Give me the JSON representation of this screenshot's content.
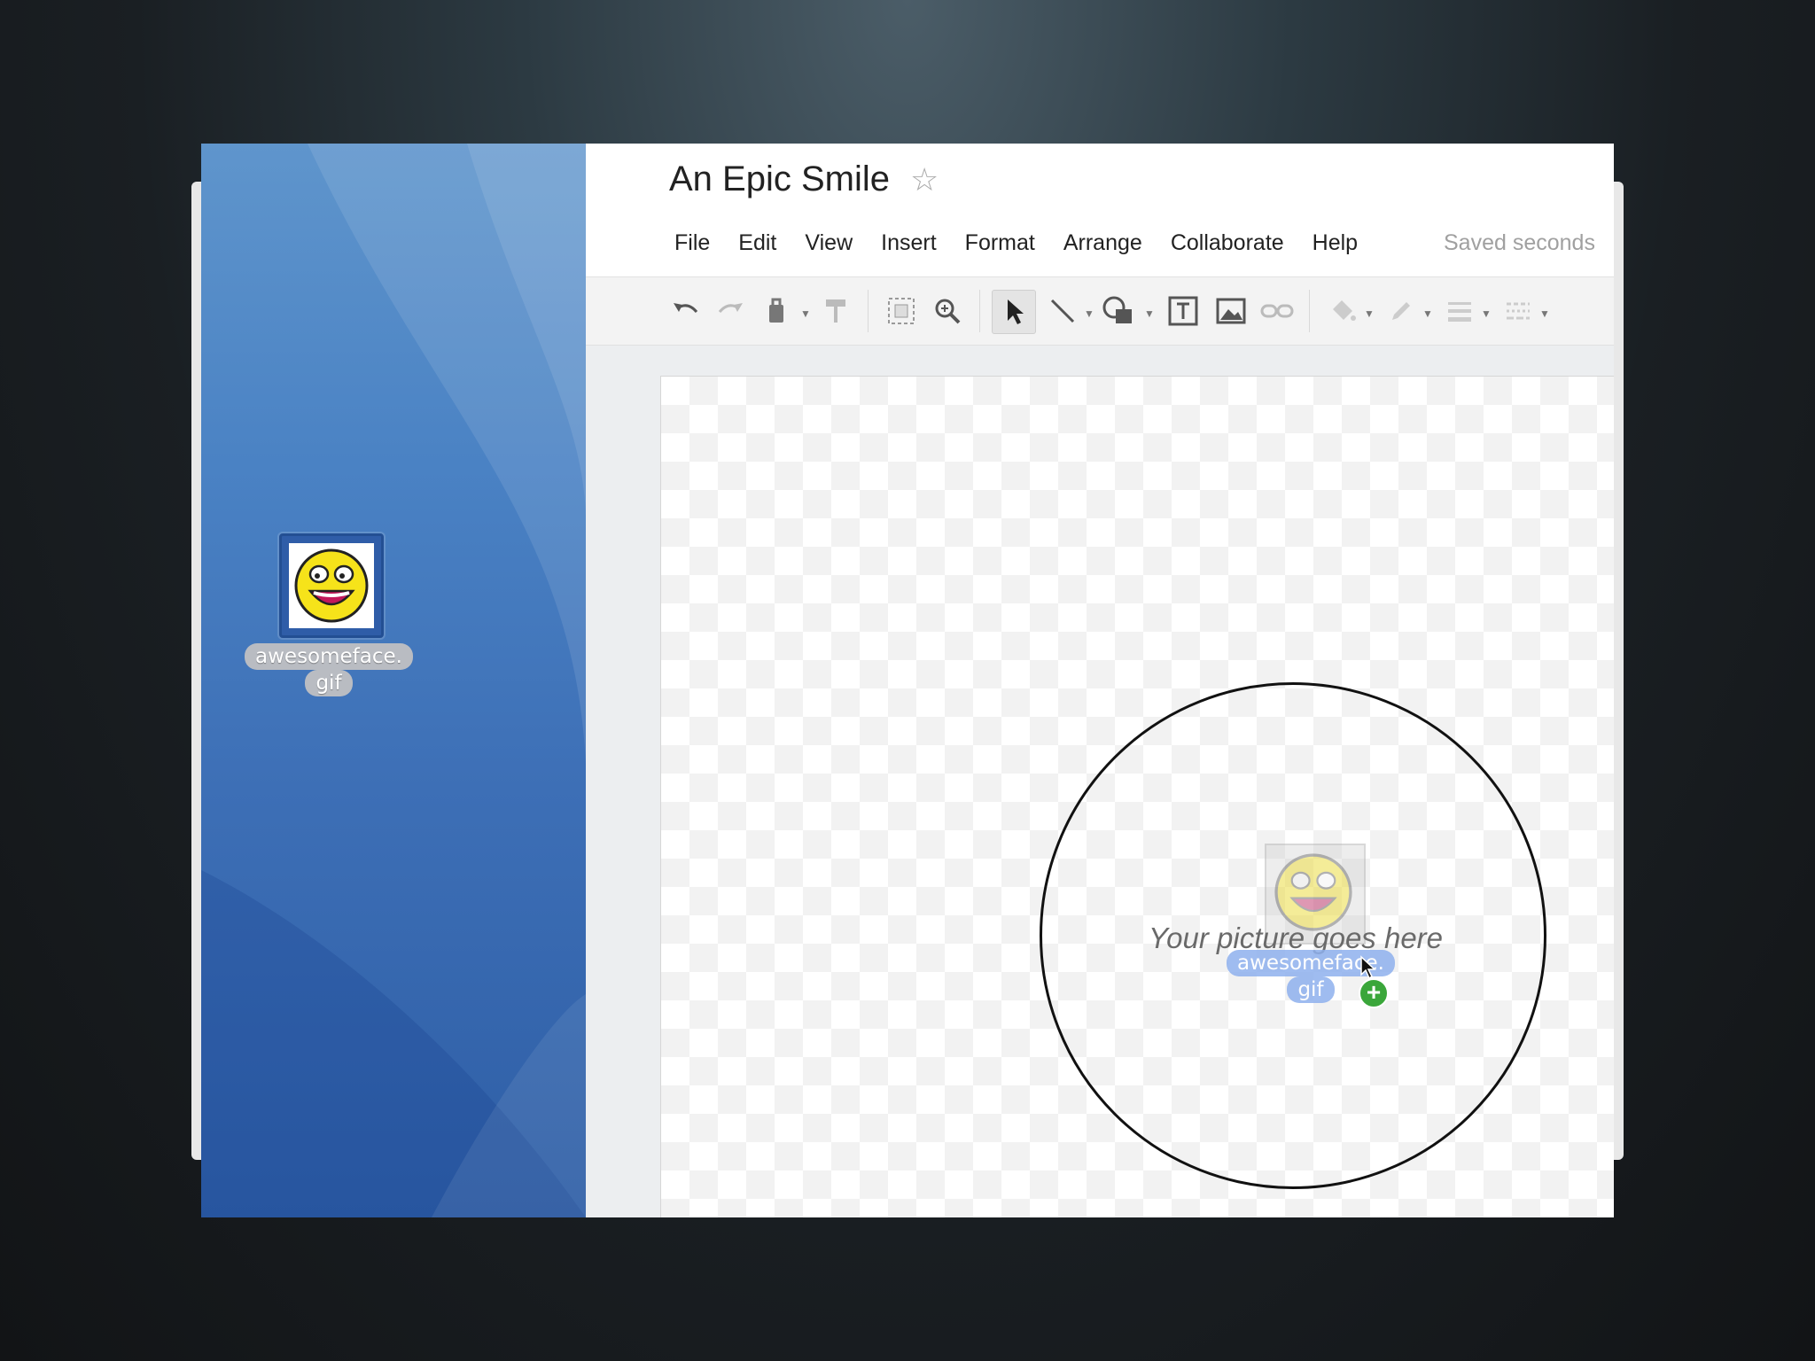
{
  "document": {
    "title": "An Epic Smile",
    "star_icon": "star-outline-icon",
    "saved_status": "Saved seconds"
  },
  "menu": {
    "items": [
      "File",
      "Edit",
      "View",
      "Insert",
      "Format",
      "Arrange",
      "Collaborate",
      "Help"
    ]
  },
  "toolbar": {
    "icons": [
      "undo-icon",
      "redo-icon",
      "paint-bucket-icon",
      "paint-format-icon",
      "zoom-fit-icon",
      "zoom-icon",
      "select-arrow-icon",
      "line-icon",
      "shape-icon",
      "text-box-icon",
      "image-icon",
      "link-icon",
      "fill-color-icon",
      "line-color-icon",
      "line-weight-icon",
      "line-dash-icon"
    ]
  },
  "desktop": {
    "file_name": "awesomeface.\ngif",
    "file_icon": "smiley-face-icon"
  },
  "canvas": {
    "placeholder_text": "Your picture goes here",
    "drag_label": "awesomeface.\ngif"
  },
  "colors": {
    "desktop_blue": "#3d6fb6",
    "drop_badge": "#3aa63a",
    "drag_label_bg": "#8fb1ee"
  }
}
